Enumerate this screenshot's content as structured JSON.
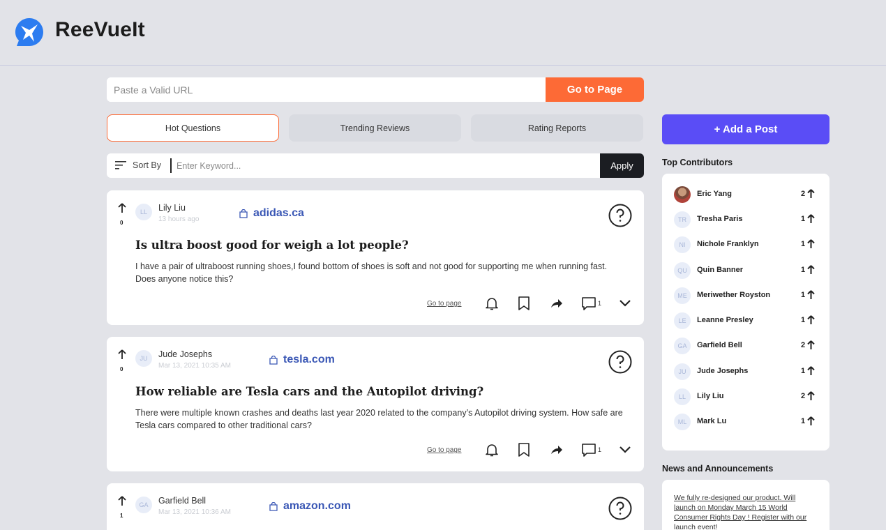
{
  "brand": {
    "name": "ReeVueIt"
  },
  "url_bar": {
    "placeholder": "Paste a Valid URL",
    "button_label": "Go to Page"
  },
  "tabs": [
    {
      "label": "Hot Questions",
      "active": true
    },
    {
      "label": "Trending Reviews",
      "active": false
    },
    {
      "label": "Rating Reports",
      "active": false
    }
  ],
  "sort_bar": {
    "label": "Sort By",
    "placeholder": "Enter Keyword...",
    "apply_label": "Apply"
  },
  "posts": [
    {
      "votes": "0",
      "avatar": "LL",
      "author": "Lily Liu",
      "time": "13 hours ago",
      "site": "adidas.ca",
      "title": "Is ultra boost good for weigh a lot people?",
      "body": "I have a pair of ultraboost running shoes,I found bottom of shoes is soft and not good for supporting me when running fast. Does anyone notice this?",
      "go_to_page": "Go to page",
      "comments": "1"
    },
    {
      "votes": "0",
      "avatar": "JU",
      "author": "Jude Josephs",
      "time": "Mar 13, 2021 10:35 AM",
      "site": "tesla.com",
      "title": "How reliable are Tesla cars and the Autopilot driving?",
      "body": "There were multiple known crashes and deaths last year 2020 related to the company’s Autopilot driving system. How safe are Tesla cars compared to other traditional cars?",
      "go_to_page": "Go to page",
      "comments": "1"
    },
    {
      "votes": "1",
      "avatar": "GA",
      "author": "Garfield Bell",
      "time": "Mar 13, 2021 10:36 AM",
      "site": "amazon.com"
    }
  ],
  "sidebar": {
    "add_post_label": "+ Add a Post",
    "contributors_title": "Top Contributors",
    "contributors": [
      {
        "initials": "",
        "name": "Eric Yang",
        "count": "2"
      },
      {
        "initials": "TR",
        "name": "Tresha Paris",
        "count": "1"
      },
      {
        "initials": "NI",
        "name": "Nichole Franklyn",
        "count": "1"
      },
      {
        "initials": "QU",
        "name": "Quin Banner",
        "count": "1"
      },
      {
        "initials": "ME",
        "name": "Meriwether Royston",
        "count": "1"
      },
      {
        "initials": "LE",
        "name": "Leanne Presley",
        "count": "1"
      },
      {
        "initials": "GA",
        "name": "Garfield Bell",
        "count": "2"
      },
      {
        "initials": "JU",
        "name": "Jude Josephs",
        "count": "1"
      },
      {
        "initials": "LL",
        "name": "Lily Liu",
        "count": "2"
      },
      {
        "initials": "ML",
        "name": "Mark Lu",
        "count": "1"
      }
    ],
    "news_title": "News and Announcements",
    "news_item": "We fully re-designed our product. Will launch on Monday March 15 World Consumer Rights Day ! Register with our launch event!"
  },
  "colors": {
    "accent_orange": "#fd6a36",
    "primary_purple": "#5a4df6",
    "link_blue": "#3a57b5",
    "background": "#e2e3e8"
  }
}
